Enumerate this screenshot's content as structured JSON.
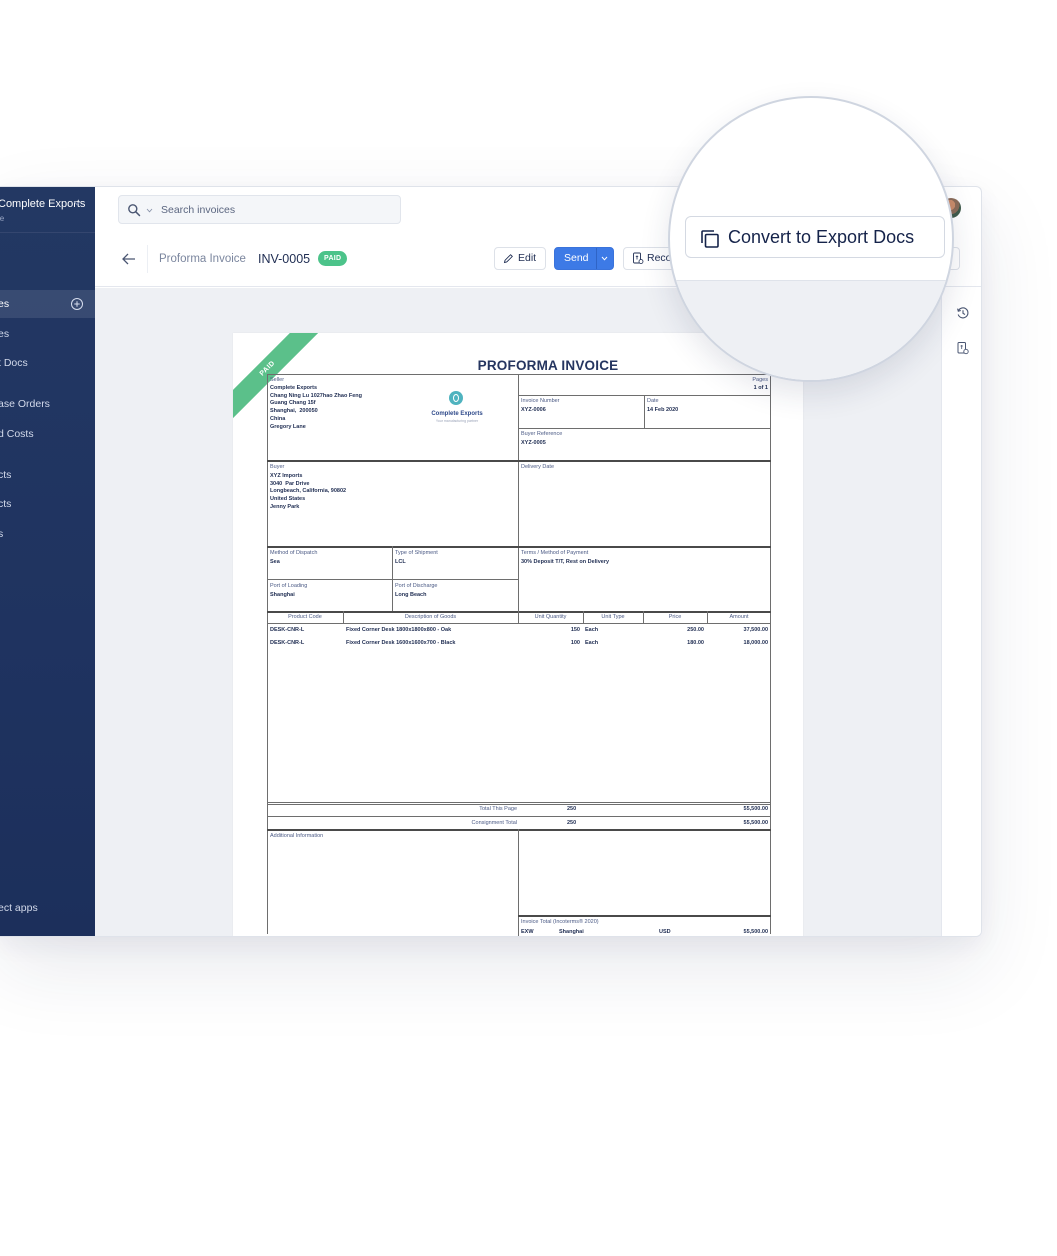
{
  "sidebar": {
    "org_name": "Complete Exports",
    "org_sub": "le",
    "items": [
      {
        "label": "es",
        "active": true
      },
      {
        "label": "es"
      },
      {
        "label": "t Docs"
      },
      {
        "label": "ase Orders"
      },
      {
        "label": "d Costs"
      },
      {
        "label": "cts"
      },
      {
        "label": "cts"
      },
      {
        "label": "s"
      },
      {
        "label": "ect apps"
      }
    ]
  },
  "topbar": {
    "search_placeholder": "Search invoices"
  },
  "header": {
    "doc_type": "Proforma Invoice",
    "doc_id": "INV-0005",
    "status_badge": "PAID",
    "edit_label": "Edit",
    "send_label": "Send",
    "record_label": "Record Payment",
    "convert_label": "Convert to Export Docs"
  },
  "colors": {
    "sidebar": "#1f3360",
    "accent": "#3d7ae6",
    "paid": "#4cc38a",
    "title": "#253560"
  },
  "invoice": {
    "title": "PROFORMA INVOICE",
    "ribbon": "PAID",
    "seller": {
      "label": "Seller",
      "lines": "Complete Exports\nChang Ning Lu 1027hao Zhao Feng\nGuang Chang 15f\nShanghai,  200050\nChina\nGregory Lane"
    },
    "logo": {
      "name": "Complete Exports",
      "tagline": "Your manufacturing partner"
    },
    "pages": {
      "label": "Pages",
      "value": "1 of 1"
    },
    "invoice_number": {
      "label": "Invoice Number",
      "value": "XYZ-0006"
    },
    "date": {
      "label": "Date",
      "value": "14 Feb 2020"
    },
    "buyer_reference": {
      "label": "Buyer Reference",
      "value": "XYZ-0005"
    },
    "buyer": {
      "label": "Buyer",
      "lines": "XYZ Imports\n3040  Par Drive\nLongbeach, California, 90802\nUnited States\nJenny Park"
    },
    "delivery_date": {
      "label": "Delivery Date",
      "value": ""
    },
    "method_of_dispatch": {
      "label": "Method of Dispatch",
      "value": "Sea"
    },
    "type_of_shipment": {
      "label": "Type of Shipment",
      "value": "LCL"
    },
    "terms": {
      "label": "Terms / Method of Payment",
      "value": "30% Deposit T/T, Rest on Delivery"
    },
    "port_of_loading": {
      "label": "Port of Loading",
      "value": "Shanghai"
    },
    "port_of_discharge": {
      "label": "Port of Discharge",
      "value": "Long Beach"
    },
    "columns": [
      "Product Code",
      "Description of Goods",
      "Unit Quantity",
      "Unit Type",
      "Price",
      "Amount"
    ],
    "rows": [
      {
        "code": "DESK-CNR-L",
        "desc": "Fixed Corner Desk 1800x1800x800 - Oak",
        "qty": "150",
        "type": "Each",
        "price": "250.00",
        "amount": "37,500.00"
      },
      {
        "code": "DESK-CNR-L",
        "desc": "Fixed Corner Desk 1600x1600x700 - Black",
        "qty": "100",
        "type": "Each",
        "price": "180.00",
        "amount": "18,000.00"
      }
    ],
    "total_this_page": {
      "label": "Total This Page",
      "qty": "250",
      "amount": "55,500.00"
    },
    "consignment_total": {
      "label": "Consignment Total",
      "qty": "250",
      "amount": "55,500.00"
    },
    "additional_info": {
      "label": "Additional Information"
    },
    "invoice_total": {
      "label": "Invoice Total (Incoterms® 2020)",
      "incoterm": "EXW",
      "place": "Shanghai",
      "currency": "USD",
      "amount": "55,500.00"
    }
  }
}
